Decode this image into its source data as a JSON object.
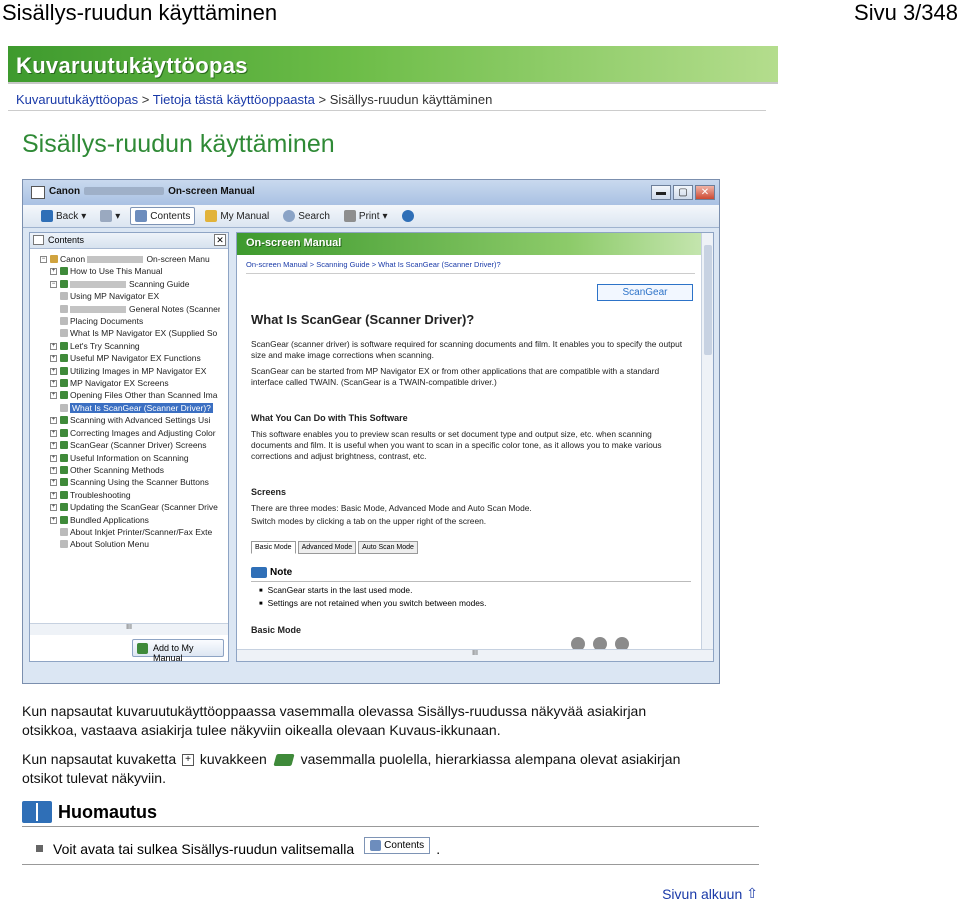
{
  "page_header": {
    "title": "Sisällys-ruudun käyttäminen",
    "page_number": "Sivu 3/348"
  },
  "banner": {
    "title": "Kuvaruutukäyttöopas"
  },
  "breadcrumb": {
    "items": [
      "Kuvaruutukäyttöopas",
      "Tietoja tästä käyttöoppaasta",
      "Sisällys-ruudun käyttäminen"
    ],
    "separator": ">"
  },
  "heading": "Sisällys-ruudun käyttäminen",
  "screenshot": {
    "window_title_left": "Canon",
    "window_title_right": "On-screen Manual",
    "window_buttons": [
      "▬",
      "▢",
      "✕"
    ],
    "toolbar": [
      "Back",
      "Contents",
      "My Manual",
      "Search",
      "Print"
    ],
    "contents_pane": {
      "header": "Contents",
      "tree": [
        "Canon",
        "How to Use This Manual",
        "Scanning Guide",
        "Using MP Navigator EX",
        "General Notes (Scanner Driver)",
        "Placing Documents",
        "What Is MP Navigator EX (Supplied So",
        "Let's Try Scanning",
        "Useful MP Navigator EX Functions",
        "Utilizing Images in MP Navigator EX",
        "MP Navigator EX Screens",
        "Opening Files Other than Scanned Ima",
        "What Is ScanGear (Scanner Driver)?",
        "Scanning with Advanced Settings Usi",
        "Correcting Images and Adjusting Color",
        "ScanGear (Scanner Driver) Screens",
        "Useful Information on Scanning",
        "Other Scanning Methods",
        "Scanning Using the Scanner Buttons",
        "Troubleshooting",
        "Updating the ScanGear (Scanner Drive",
        "Bundled Applications",
        "About Inkjet Printer/Scanner/Fax Exte",
        "About Solution Menu"
      ],
      "tree_root_suffix": "On-screen Manu",
      "hscroll": "III",
      "add_button": "Add to My Manual"
    },
    "content_pane": {
      "banner": "On-screen Manual",
      "breadcrumb": "On-screen Manual > Scanning Guide > What Is ScanGear (Scanner Driver)?",
      "scangear_button": "ScanGear",
      "title": "What Is ScanGear (Scanner Driver)?",
      "p1": "ScanGear (scanner driver) is software required for scanning documents and film. It enables you to specify the output size and make image corrections when scanning.",
      "p2": "ScanGear can be started from MP Navigator EX or from other applications that are compatible with a standard interface called TWAIN. (ScanGear is a TWAIN-compatible driver.)",
      "h_can_do": "What You Can Do with This Software",
      "p3": "This software enables you to preview scan results or set document type and output size, etc. when scanning documents and film. It is useful when you want to scan in a specific color tone, as it allows you to make various corrections and adjust brightness, contrast, etc.",
      "h_screens": "Screens",
      "p4": "There are three modes: Basic Mode, Advanced Mode and Auto Scan Mode.",
      "p5": "Switch modes by clicking a tab on the upper right of the screen.",
      "tabs": [
        "Basic Mode",
        "Advanced Mode",
        "Auto Scan Mode"
      ],
      "note_title": "Note",
      "notes": [
        "ScanGear starts in the last used mode.",
        "Settings are not retained when you switch between modes."
      ],
      "h_basic": "Basic Mode",
      "hscroll": "III"
    }
  },
  "body": {
    "p1_line1": "Kun napsautat kuvaruutukäyttöoppaassa vasemmalla olevassa Sisällys-ruudussa näkyvää asiakirjan",
    "p1_line2": "otsikkoa, vastaava asiakirja tulee näkyviin oikealla olevaan Kuvaus-ikkunaan.",
    "p2_part1": "Kun napsautat kuvaketta",
    "p2_plus": "+",
    "p2_part2": "kuvakkeen",
    "p2_part3": "vasemmalla puolella, hierarkiassa alempana olevat asiakirjan",
    "p2_line2": "otsikot tulevat näkyviin."
  },
  "note": {
    "title": "Huomautus",
    "item_text": "Voit avata tai sulkea Sisällys-ruudun valitsemalla",
    "button_label": "Contents",
    "item_end": "."
  },
  "top_link": {
    "label": "Sivun alkuun",
    "arrow": "⇧"
  }
}
